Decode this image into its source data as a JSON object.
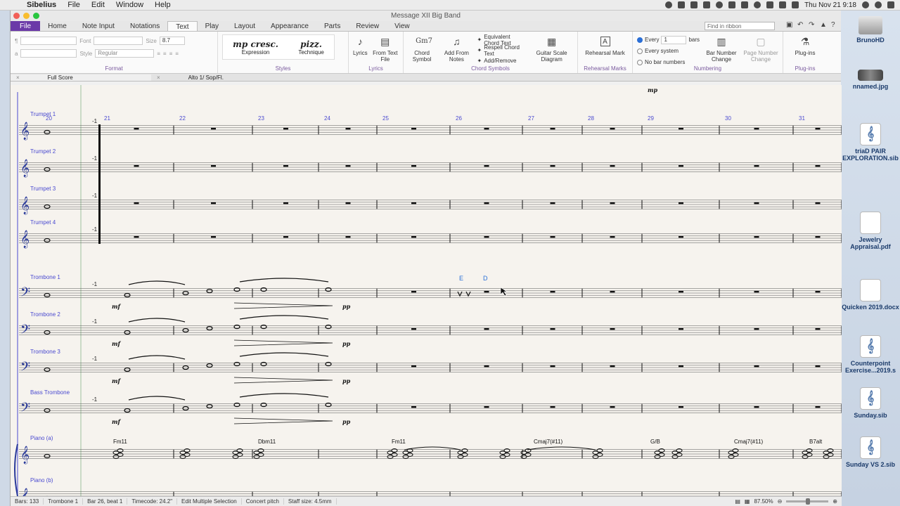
{
  "menubar": {
    "app": "Sibelius",
    "items": [
      "File",
      "Edit",
      "Window",
      "Help"
    ],
    "clock": "Thu Nov 21  9:18"
  },
  "window": {
    "title": "Message XII Big Band"
  },
  "ribbon_tabs": [
    "File",
    "Home",
    "Note Input",
    "Notations",
    "Text",
    "Play",
    "Layout",
    "Appearance",
    "Parts",
    "Review",
    "View"
  ],
  "active_tab": "Text",
  "search": {
    "placeholder": "Find in ribbon"
  },
  "format": {
    "font_label": "Font",
    "size_label": "Size",
    "size_value": "8.7",
    "style_label": "Style",
    "style_value": "Regular",
    "group_label": "Format"
  },
  "styles": {
    "group_label": "Styles",
    "items": [
      {
        "preview": "mp cresc.",
        "name": "Expression"
      },
      {
        "preview": "pizz.",
        "name": "Technique"
      }
    ]
  },
  "lyrics": {
    "group_label": "Lyrics",
    "buttons": [
      "Lyrics",
      "From Text File"
    ]
  },
  "chord_symbols": {
    "group_label": "Chord Symbols",
    "chord_icon": "Gm7",
    "buttons": [
      "Chord Symbol",
      "Add From Notes"
    ],
    "list": [
      "Equivalent Chord Text",
      "Respell Chord Text",
      "Add/Remove"
    ],
    "guitar": "Guitar Scale Diagram"
  },
  "rehearsal": {
    "group_label": "Rehearsal Marks",
    "button": "Rehearsal Mark"
  },
  "numbering": {
    "group_label": "Numbering",
    "every_label": "Every",
    "every_value": "1",
    "bars_label": "bars",
    "opt_system": "Every system",
    "opt_none": "No bar numbers",
    "bn_change": "Bar Number Change",
    "pn_change": "Page Number Change"
  },
  "plugins": {
    "group_label": "Plug-ins",
    "button": "Plug-ins"
  },
  "panel_tabs": [
    "Full Score",
    "Alto 1/ Sop/Fl."
  ],
  "score": {
    "instruments": [
      "Trumpet 1",
      "Trumpet 2",
      "Trumpet 3",
      "Trumpet 4",
      "Trombone 1",
      "Trombone 2",
      "Trombone 3",
      "Bass Trombone",
      "Piano (a)",
      "Piano (b)"
    ],
    "bar_numbers": [
      "20",
      "21",
      "22",
      "23",
      "24",
      "25",
      "26",
      "27",
      "28",
      "29",
      "30",
      "31"
    ],
    "dynamics": [
      "mf",
      "pp",
      "mp"
    ],
    "chords": [
      "Fm11",
      "Dbm11",
      "Fm11",
      "Cmaj7(#11)",
      "G/B",
      "Cmaj7(#11)",
      "B7alt"
    ],
    "rehearsal": [
      "E",
      "D"
    ],
    "minus_one": "-1"
  },
  "status": {
    "bars": "Bars: 133",
    "instrument": "Trombone 1",
    "position": "Bar 26, beat 1",
    "timecode": "Timecode: 24.2\"",
    "mode": "Edit Multiple Selection",
    "pitch": "Concert pitch",
    "staff": "Staff size: 4.5mm",
    "zoom": "87.50%"
  },
  "desktop_icons": [
    {
      "label": "BrunoHD",
      "kind": "drive"
    },
    {
      "label": "nnamed.jpg",
      "kind": "img"
    },
    {
      "label": "triaD PAIR EXPLORATION.sib",
      "kind": "sib"
    },
    {
      "label": "Jewelry Appraisal.pdf",
      "kind": "doc"
    },
    {
      "label": "Quicken 2019.docx",
      "kind": "doc"
    },
    {
      "label": "Counterpoint Exercise...2019.s",
      "kind": "sib"
    },
    {
      "label": "Sunday.sib",
      "kind": "sib"
    },
    {
      "label": "Sunday VS 2.sib",
      "kind": "sib"
    }
  ]
}
